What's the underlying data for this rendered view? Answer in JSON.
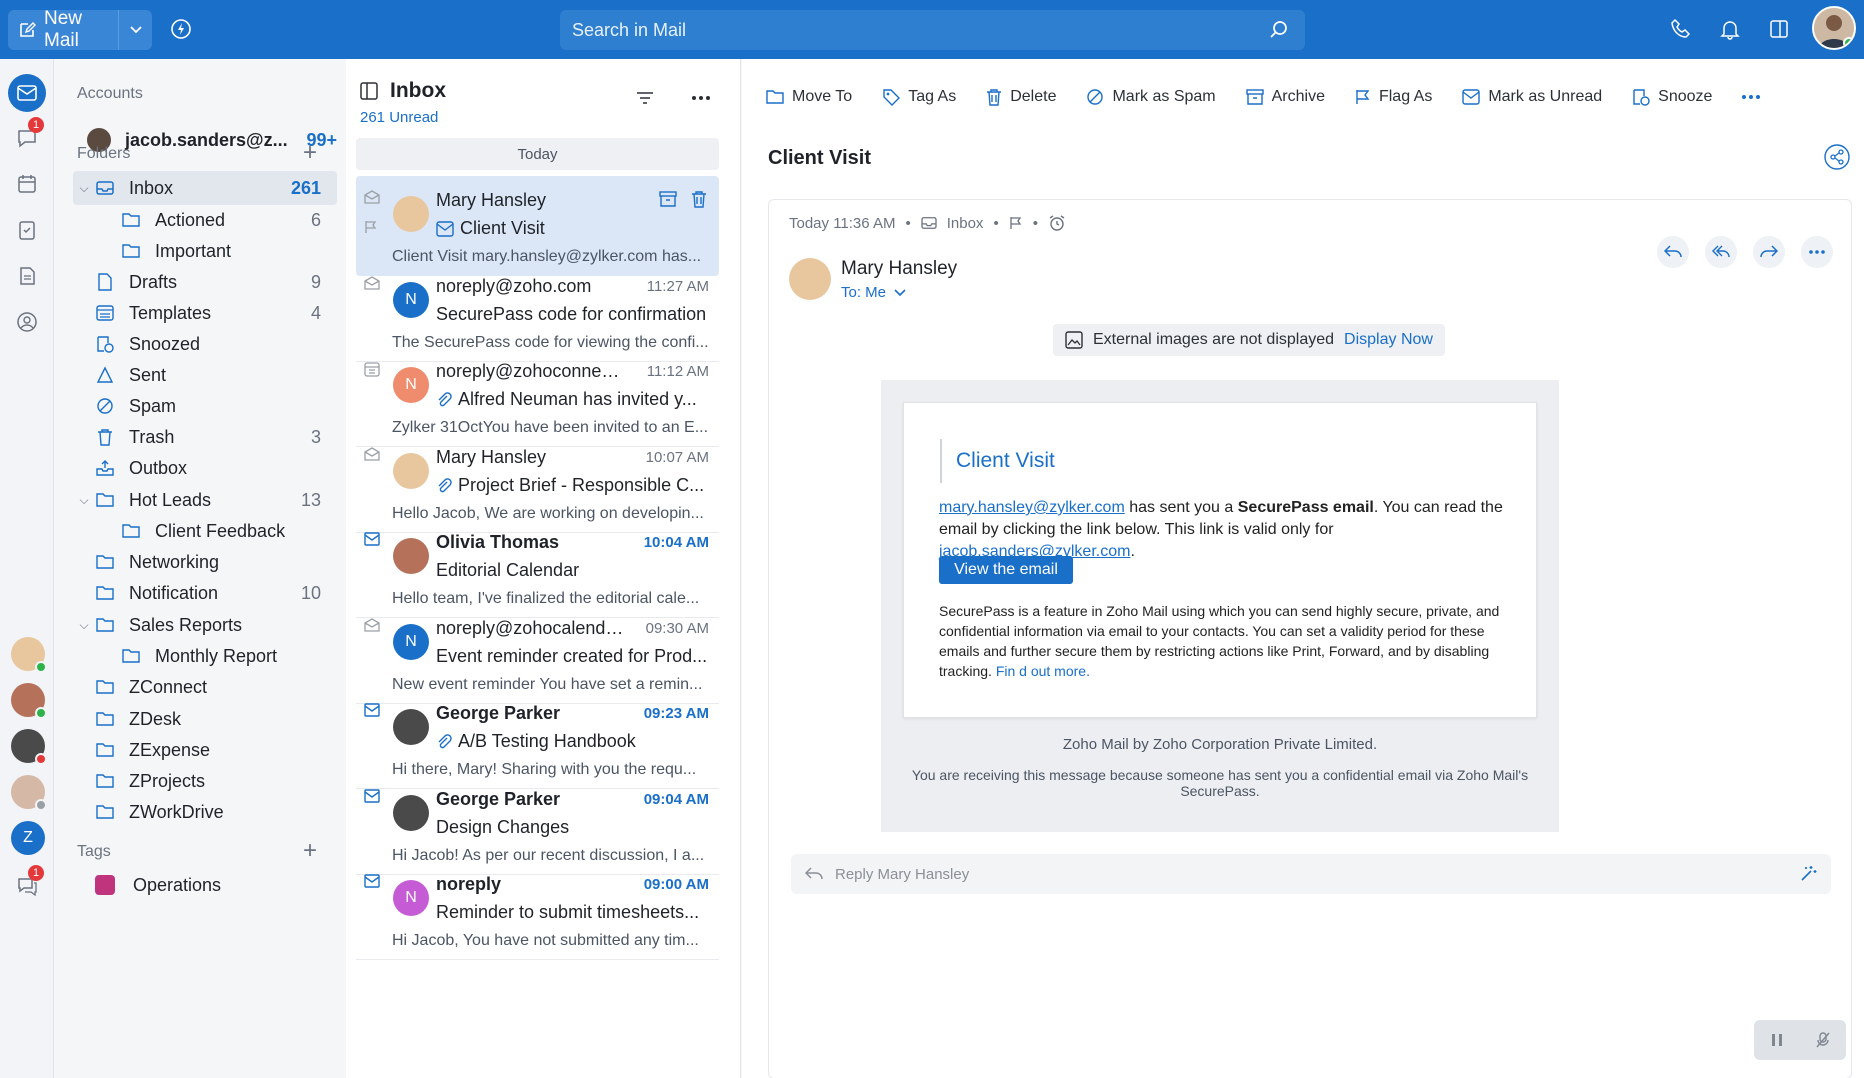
{
  "topbar": {
    "new_mail_label": "New Mail",
    "search_placeholder": "Search in Mail"
  },
  "rail": {
    "chat_badge": "1",
    "bottom_badge": "1",
    "user_initial": "Z"
  },
  "folders": {
    "accounts_label": "Accounts",
    "account_name": "jacob.sanders@z...",
    "account_count": "99+",
    "folders_label": "Folders",
    "items": [
      {
        "label": "Inbox",
        "count": "261"
      },
      {
        "label": "Actioned",
        "count": "6"
      },
      {
        "label": "Important",
        "count": ""
      },
      {
        "label": "Drafts",
        "count": "9"
      },
      {
        "label": "Templates",
        "count": "4"
      },
      {
        "label": "Snoozed",
        "count": ""
      },
      {
        "label": "Sent",
        "count": ""
      },
      {
        "label": "Spam",
        "count": ""
      },
      {
        "label": "Trash",
        "count": "3"
      },
      {
        "label": "Outbox",
        "count": ""
      },
      {
        "label": "Hot Leads",
        "count": "13"
      },
      {
        "label": "Client Feedback",
        "count": ""
      },
      {
        "label": "Networking",
        "count": ""
      },
      {
        "label": "Notification",
        "count": "10"
      },
      {
        "label": "Sales Reports",
        "count": ""
      },
      {
        "label": "Monthly Report",
        "count": ""
      },
      {
        "label": "ZConnect",
        "count": ""
      },
      {
        "label": "ZDesk",
        "count": ""
      },
      {
        "label": "ZExpense",
        "count": ""
      },
      {
        "label": "ZProjects",
        "count": ""
      },
      {
        "label": "ZWorkDrive",
        "count": ""
      }
    ],
    "tags_label": "Tags",
    "tags": [
      {
        "label": "Operations",
        "color": "#c0347e"
      }
    ]
  },
  "list": {
    "title": "Inbox",
    "unread": "261 Unread",
    "day": "Today",
    "mails": [
      {
        "from": "Mary Hansley",
        "time": "",
        "subject": "Client Visit",
        "preview": "Client Visit mary.hansley@zylker.com has...",
        "initial": "",
        "color": "#e8c79e"
      },
      {
        "from": "noreply@zoho.com",
        "time": "11:27 AM",
        "subject": "SecurePass code for confirmation",
        "preview": "The SecurePass code for viewing the confi...",
        "initial": "N",
        "color": "#1a6fc9"
      },
      {
        "from": "noreply@zohoconnect....",
        "time": "11:12 AM",
        "subject": "Alfred Neuman has invited y...",
        "preview": "Zylker 31OctYou have been invited to an E...",
        "initial": "N",
        "color": "#ef8c6e"
      },
      {
        "from": "Mary Hansley",
        "time": "10:07 AM",
        "subject": "Project Brief - Responsible C...",
        "preview": "Hello Jacob, We are working on developin...",
        "initial": "",
        "color": "#e8c79e"
      },
      {
        "from": "Olivia Thomas",
        "time": "10:04 AM",
        "subject": "Editorial Calendar",
        "preview": "Hello team, I've finalized the editorial cale...",
        "initial": "",
        "color": "#b5715a"
      },
      {
        "from": "noreply@zohocalenda...",
        "time": "09:30 AM",
        "subject": "Event reminder created for Prod...",
        "preview": "New event reminder You have set a remin...",
        "initial": "N",
        "color": "#1a6fc9"
      },
      {
        "from": "George Parker",
        "time": "09:23 AM",
        "subject": "A/B Testing Handbook",
        "preview": "Hi there, Mary! Sharing with you the requ...",
        "initial": "",
        "color": "#4a4a4a"
      },
      {
        "from": "George Parker",
        "time": "09:04 AM",
        "subject": "Design Changes",
        "preview": "Hi Jacob! As per our recent discussion, I a...",
        "initial": "",
        "color": "#4a4a4a"
      },
      {
        "from": "noreply",
        "time": "09:00 AM",
        "subject": "Reminder to submit timesheets...",
        "preview": "Hi Jacob, You have not submitted any tim...",
        "initial": "N",
        "color": "#c65bd6"
      }
    ]
  },
  "toolbar": {
    "move_to": "Move To",
    "tag_as": "Tag As",
    "delete": "Delete",
    "mark_spam": "Mark as Spam",
    "archive": "Archive",
    "flag_as": "Flag As",
    "mark_unread": "Mark as Unread",
    "snooze": "Snooze"
  },
  "reader": {
    "title": "Client Visit",
    "meta_time": "Today 11:36 AM",
    "meta_folder": "Inbox",
    "sender": "Mary Hansley",
    "to": "To: Me",
    "ext_notice": "External images are not displayed",
    "display_now": "Display Now",
    "body_title": "Client Visit",
    "body_link1": "mary.hansley@zylker.com",
    "body_text1": " has sent you a ",
    "body_bold": "SecurePass email",
    "body_text2": ". You can read the email by clicking the link below. This link is valid only for ",
    "body_link2": "jacob.sanders@zylker.com",
    "body_text3": ".",
    "view_button": "View the email",
    "body_para2": "SecurePass is a feature in Zoho Mail using which you can send highly secure, private, and confidential information via email to your contacts. You can set a validity period for these emails and further secure them by restricting actions like Print, Forward, and by disabling tracking. ",
    "find_out": "Fin d out more.",
    "footer1": "Zoho Mail by Zoho Corporation Private Limited.",
    "footer2": "You are receiving this message because someone has sent you a confidential email via Zoho Mail's SecurePass.",
    "reply_placeholder": "Reply Mary Hansley"
  }
}
